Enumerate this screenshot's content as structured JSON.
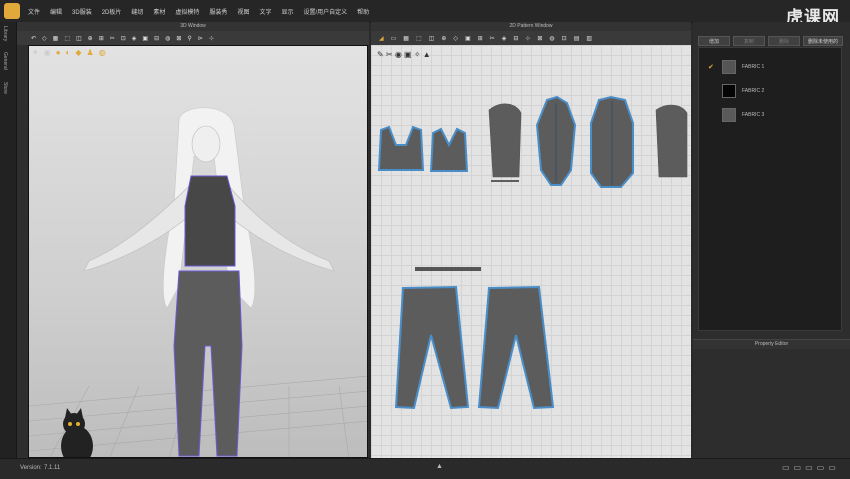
{
  "menu": [
    "文件",
    "编辑",
    "3D服装",
    "2D板片",
    "缝纫",
    "素材",
    "虚拟模特",
    "服装秀",
    "视图",
    "文字",
    "显示",
    "设置/用户自定义",
    "帮助"
  ],
  "watermark": "虎课网",
  "left_tabs": {
    "library": "Library",
    "general": "General",
    "store": "Store"
  },
  "window3d": {
    "title": "3D Window",
    "tools": [
      "↶",
      "◇",
      "▦",
      "⬚",
      "◫",
      "⊕",
      "⊞",
      "✂",
      "⊡",
      "◈",
      "▣",
      "⊟",
      "◍",
      "⊠",
      "⚲",
      "⊳",
      "⊹"
    ]
  },
  "window2d": {
    "title": "2D Pattern Window",
    "tools": [
      "◢",
      "▭",
      "▦",
      "⬚",
      "◫",
      "⊕",
      "◇",
      "▣",
      "⊞",
      "✂",
      "◈",
      "⊟",
      "⊹",
      "⊠",
      "◍",
      "⊡",
      "▤",
      "▥"
    ]
  },
  "object_browser": {
    "buttons": [
      "增加",
      "复制",
      "删除",
      "删除未使用的"
    ],
    "fabrics": [
      {
        "name": "FABRIC 1",
        "color": "#555555",
        "checked": true
      },
      {
        "name": "FABRIC 2",
        "color": "#050505",
        "checked": false
      },
      {
        "name": "FABRIC 3",
        "color": "#5a5a5a",
        "checked": false
      }
    ]
  },
  "property_editor": "Property Editor",
  "status": {
    "label": "Version:",
    "value": "7.1.11"
  },
  "colors": {
    "accent": "#e0a93b",
    "outline": "#4a8ec9",
    "seam": "#6b5bd6",
    "pattern": "#5c5c5c"
  }
}
